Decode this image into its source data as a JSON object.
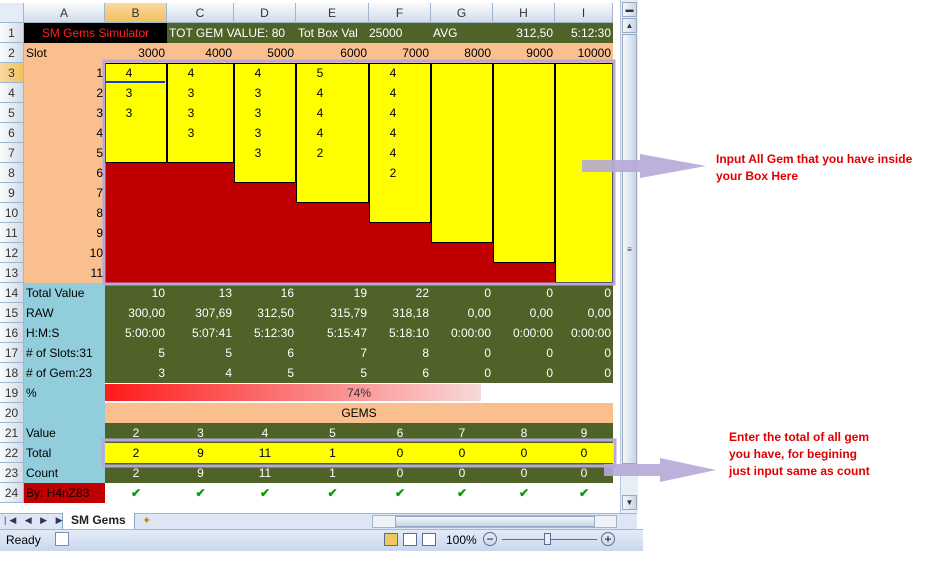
{
  "columns": [
    "A",
    "B",
    "C",
    "D",
    "E",
    "F",
    "G",
    "H",
    "I"
  ],
  "rows": [
    "1",
    "2",
    "3",
    "4",
    "5",
    "6",
    "7",
    "8",
    "9",
    "10",
    "11",
    "12",
    "13",
    "14",
    "15",
    "16",
    "17",
    "18",
    "19",
    "20",
    "21",
    "22",
    "23",
    "24"
  ],
  "header": {
    "title": "SM Gems Simulator",
    "tot_gem_value": "TOT GEM VALUE: 80",
    "tot_box_val_label": "Tot Box Val",
    "tot_box_val": "25000",
    "avg_label": "AVG",
    "avg_value": "312,50",
    "avg_time": "5:12:30"
  },
  "slot_row": {
    "label": "Slot",
    "values": [
      "3000",
      "4000",
      "5000",
      "6000",
      "7000",
      "8000",
      "9000",
      "10000"
    ]
  },
  "numbering": [
    "1",
    "2",
    "3",
    "4",
    "5",
    "6",
    "7",
    "8",
    "9",
    "10",
    "11"
  ],
  "gem_grid": [
    [
      "4",
      "4",
      "4",
      "5",
      "4"
    ],
    [
      "3",
      "3",
      "3",
      "4",
      "4"
    ],
    [
      "3",
      "3",
      "3",
      "4",
      "4"
    ],
    [
      "",
      "3",
      "3",
      "4",
      "4"
    ],
    [
      "",
      "",
      "3",
      "2",
      "4"
    ],
    [
      "",
      "",
      "",
      "",
      "2"
    ]
  ],
  "stats": [
    {
      "label": "Total Value",
      "values": [
        "10",
        "13",
        "16",
        "19",
        "22",
        "0",
        "0",
        "0"
      ]
    },
    {
      "label": "RAW",
      "values": [
        "300,00",
        "307,69",
        "312,50",
        "315,79",
        "318,18",
        "0,00",
        "0,00",
        "0,00"
      ]
    },
    {
      "label": "H:M:S",
      "values": [
        "5:00:00",
        "5:07:41",
        "5:12:30",
        "5:15:47",
        "5:18:10",
        "0:00:00",
        "0:00:00",
        "0:00:00"
      ]
    },
    {
      "label": "# of Slots:31",
      "values": [
        "5",
        "5",
        "6",
        "7",
        "8",
        "0",
        "0",
        "0"
      ]
    },
    {
      "label": "# of Gem:23",
      "values": [
        "3",
        "4",
        "5",
        "5",
        "6",
        "0",
        "0",
        "0"
      ]
    }
  ],
  "percent": {
    "label": "%",
    "value": "74%",
    "fraction": 0.74
  },
  "gems_label": "GEMS",
  "gem_value_row": {
    "label": "Value",
    "values": [
      "2",
      "3",
      "4",
      "5",
      "6",
      "7",
      "8",
      "9"
    ]
  },
  "gem_total_row": {
    "label": "Total",
    "values": [
      "2",
      "9",
      "11",
      "1",
      "0",
      "0",
      "0",
      "0"
    ]
  },
  "gem_count_row": {
    "label": "Count",
    "values": [
      "2",
      "9",
      "11",
      "1",
      "0",
      "0",
      "0",
      "0"
    ]
  },
  "author": "By: H4nZ83",
  "checks": [
    "✔",
    "✔",
    "✔",
    "✔",
    "✔",
    "✔",
    "✔",
    "✔"
  ],
  "annotations": {
    "box": "Input All Gem that you have inside your Box Here",
    "total": "Enter the total of all gem you have, for begining just input same as count"
  },
  "sheet_tab": "SM Gems",
  "status": {
    "ready": "Ready",
    "zoom": "100%"
  },
  "colors": {
    "dark_green": "#4f6228",
    "peach": "#fabf8f",
    "yellow": "#ffff00",
    "red": "#c00000",
    "light_blue": "#92cddc",
    "annotation": "#e00000",
    "check": "#00a000"
  }
}
